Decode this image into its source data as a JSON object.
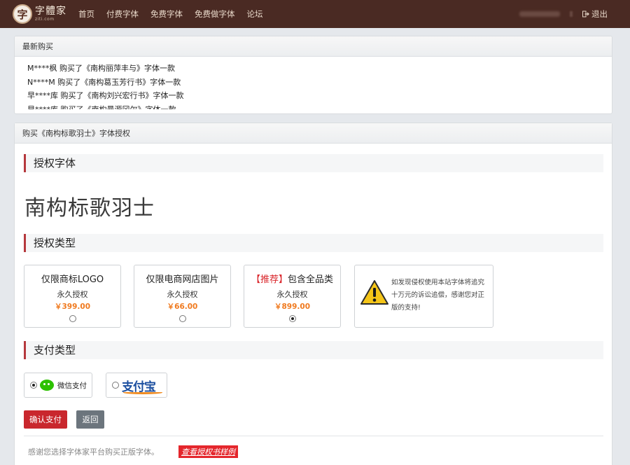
{
  "nav": {
    "logo_text": "字體家",
    "logo_sub": "ziti.com",
    "links": [
      "首页",
      "付费字体",
      "免费字体",
      "免费做字体",
      "论坛"
    ],
    "logout_label": "退出"
  },
  "recent": {
    "title": "最新购买",
    "items": [
      "M****枫 购买了《南构丽萍丰与》字体一款",
      "N****M 购买了《南构葛玉芳行书》字体一款",
      "早****库 购买了《南构刘兴宏行书》字体一款",
      "早****库 购买了《南构曼源冈尔》字体一款"
    ]
  },
  "purchase": {
    "title": "购买《南构标歌羽士》字体授权",
    "font_section": "授权字体",
    "font_name": "南构标歌羽士",
    "type_section": "授权类型",
    "options": [
      {
        "tag": "",
        "title": "仅限商标LOGO",
        "term": "永久授权",
        "price": "￥399.00",
        "selected": false
      },
      {
        "tag": "",
        "title": "仅限电商网店图片",
        "term": "永久授权",
        "price": "￥66.00",
        "selected": false
      },
      {
        "tag": "【推荐】",
        "title": "包含全品类",
        "term": "永久授权",
        "price": "￥899.00",
        "selected": true
      }
    ],
    "warning": "如发现侵权使用本站字体将追究十万元的诉讼追偿，感谢您对正版的支持!",
    "pay_section": "支付类型",
    "pay_wechat": "微信支付",
    "pay_alipay": "支付宝",
    "confirm_label": "确认支付",
    "back_label": "返回",
    "thanks": "感谢您选择字体家平台购买正版字体。",
    "sample_link": "查看授权书样例"
  },
  "colors": {
    "nav_bg": "#4a2a23",
    "accent_red": "#c9272d",
    "price_orange": "#f07a1f",
    "wechat_green": "#2dc100",
    "alipay_blue": "#1c4fa0"
  }
}
